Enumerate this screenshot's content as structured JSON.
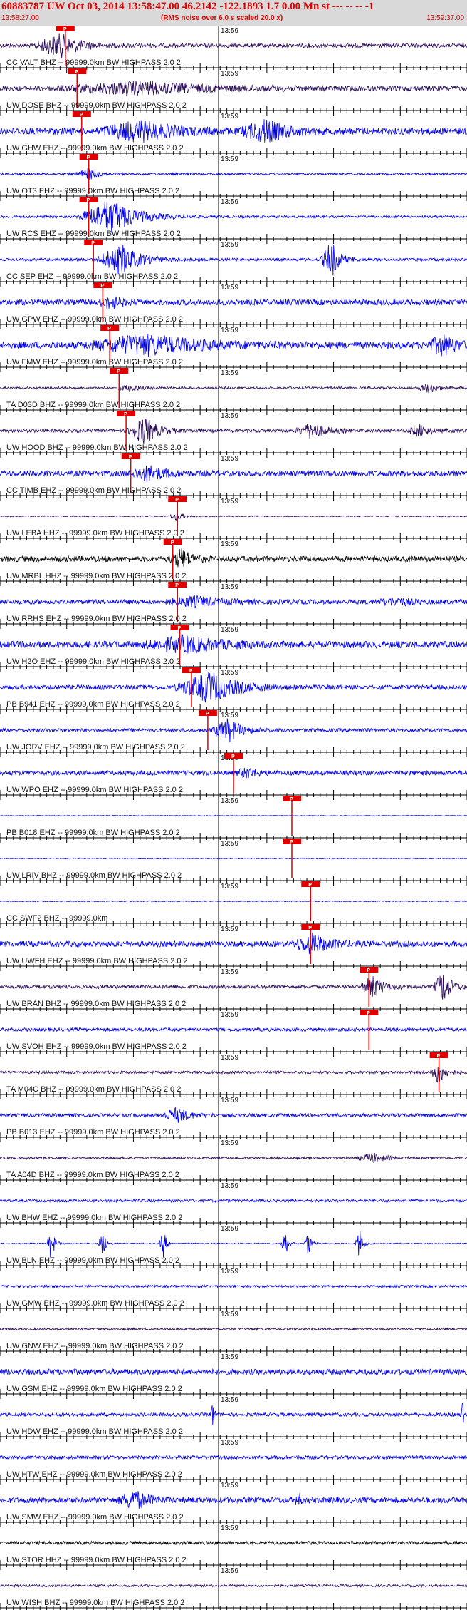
{
  "header": {
    "title": "60883787 UW Oct 03, 2014 13:58:47.00   46.2142 -122.1893  1.7 0.00 Mn st --- -- --  -1",
    "start_time": "13:58:27.00",
    "note": "(RMS noise over 6.0 s scaled 20.0 x)",
    "end_time": "13:59:37.00"
  },
  "pick_label": "P",
  "minute_label": "13:59",
  "colors": {
    "red": "#e00000",
    "blue": "#0000ee",
    "purple": "#2a0a5a",
    "black": "#000000"
  },
  "traces": [
    {
      "label": "CC VALT BHZ -- 99999.0km BW  HIGHPASS  2.0  2",
      "color": "purple",
      "pick": 0.14,
      "amp": 0.18,
      "bursts": [
        [
          0.13,
          0.06,
          1.0
        ]
      ]
    },
    {
      "label": "UW DOSE BHZ -- 99999.0km BW  HIGHPASS  2.0  2",
      "color": "purple",
      "pick": 0.165,
      "amp": 0.22,
      "bursts": [
        [
          0.3,
          0.2,
          0.5
        ]
      ]
    },
    {
      "label": "UW GHW EHZ -- 99999.0km BW  HIGHPASS  2.0  2",
      "color": "blue",
      "pick": 0.175,
      "amp": 0.3,
      "bursts": [
        [
          0.3,
          0.1,
          0.8
        ],
        [
          0.57,
          0.06,
          0.9
        ]
      ]
    },
    {
      "label": "UW OT3 EHZ -- 99999.0km BW  HIGHPASS  2.0  2",
      "color": "blue",
      "pick": 0.19,
      "amp": 0.1,
      "bursts": [
        [
          0.19,
          0.03,
          0.5
        ]
      ]
    },
    {
      "label": "UW RCS EHZ -- 99999.0km BW  HIGHPASS  2.0  2",
      "color": "blue",
      "pick": 0.19,
      "amp": 0.1,
      "bursts": [
        [
          0.24,
          0.08,
          1.5
        ]
      ]
    },
    {
      "label": "CC SEP EHZ -- 99999.0km BW  HIGHPASS  2.0  2",
      "color": "blue",
      "pick": 0.2,
      "amp": 0.12,
      "bursts": [
        [
          0.26,
          0.06,
          1.3
        ],
        [
          0.71,
          0.025,
          1.6
        ]
      ]
    },
    {
      "label": "UW GPW EHZ -- 99999.0km BW  HIGHPASS  2.0  2",
      "color": "blue",
      "pick": 0.22,
      "amp": 0.25,
      "bursts": [
        [
          0.24,
          0.03,
          0.5
        ]
      ]
    },
    {
      "label": "UW FMW EHZ -- 99999.0km BW  HIGHPASS  2.0  2",
      "color": "blue",
      "pick": 0.235,
      "amp": 0.3,
      "bursts": [
        [
          0.32,
          0.15,
          0.8
        ],
        [
          0.95,
          0.04,
          0.8
        ]
      ]
    },
    {
      "label": "TA D03D BHZ -- 99999.0km BW  HIGHPASS  2.0  2",
      "color": "purple",
      "pick": 0.255,
      "amp": 0.1,
      "bursts": [
        [
          0.28,
          0.03,
          0.3
        ],
        [
          0.92,
          0.03,
          0.4
        ]
      ]
    },
    {
      "label": "UW HOOD BHZ -- 99999.0km BW  HIGHPASS  2.0  2",
      "color": "purple",
      "pick": 0.27,
      "amp": 0.15,
      "bursts": [
        [
          0.31,
          0.04,
          1.2
        ],
        [
          0.67,
          0.04,
          0.7
        ],
        [
          0.9,
          0.03,
          0.5
        ]
      ]
    },
    {
      "label": "CC TIMB EHZ -- 99999.0km BW  HIGHPASS  2.0  2",
      "color": "blue",
      "pick": 0.28,
      "amp": 0.25,
      "bursts": [
        [
          0.32,
          0.05,
          0.6
        ]
      ]
    },
    {
      "label": "UW LEBA HHZ -- 99999.0km BW  HIGHPASS  2.0  2",
      "color": "purple",
      "pick": 0.38,
      "amp": 0.05,
      "bursts": [
        [
          0.38,
          0.02,
          0.4
        ]
      ]
    },
    {
      "label": "UW MRBL HHZ -- 99999.0km BW  HIGHPASS  2.0  2",
      "color": "black",
      "pick": 0.37,
      "amp": 0.25,
      "bursts": [
        [
          0.39,
          0.03,
          0.8
        ]
      ]
    },
    {
      "label": "UW RRHS EHZ -- 99999.0km BW  HIGHPASS  2.0  2",
      "color": "blue",
      "pick": 0.38,
      "amp": 0.2,
      "bursts": [
        [
          0.42,
          0.08,
          0.4
        ],
        [
          0.85,
          0.05,
          0.3
        ]
      ]
    },
    {
      "label": "UW H2O EHZ -- 99999.0km BW  HIGHPASS  2.0  2",
      "color": "blue",
      "pick": 0.385,
      "amp": 0.3,
      "bursts": [
        [
          0.4,
          0.1,
          0.6
        ]
      ]
    },
    {
      "label": "PB B941 EHZ -- 99999.0km BW  HIGHPASS  2.0  2",
      "color": "blue",
      "pick": 0.41,
      "amp": 0.2,
      "bursts": [
        [
          0.45,
          0.08,
          1.3
        ]
      ]
    },
    {
      "label": "UW JORV EHZ -- 99999.0km BW  HIGHPASS  2.0  2",
      "color": "blue",
      "pick": 0.445,
      "amp": 0.15,
      "bursts": [
        [
          0.49,
          0.04,
          1.0
        ]
      ]
    },
    {
      "label": "UW WPO EHZ -- 99999.0km BW  HIGHPASS  2.0  2",
      "color": "blue",
      "pick": 0.5,
      "amp": 0.2,
      "bursts": [
        [
          0.53,
          0.03,
          0.4
        ]
      ]
    },
    {
      "label": "PB B018 EHZ -- 99999.0km BW  HIGHPASS  2.0  2",
      "color": "blue",
      "pick": 0.625,
      "amp": 0.03,
      "bursts": []
    },
    {
      "label": "UW LRIV BHZ -- 99999.0km BW  HIGHPASS  2.0  2",
      "color": "blue",
      "pick": 0.625,
      "amp": 0.04,
      "bursts": []
    },
    {
      "label": "CC SWF2 BHZ -- 99999.0km",
      "color": "blue",
      "pick": 0.665,
      "amp": 0.04,
      "bursts": []
    },
    {
      "label": "UW UWFH EHZ -- 99999.0km BW  HIGHPASS  2.0  2",
      "color": "blue",
      "pick": 0.665,
      "amp": 0.25,
      "bursts": [
        [
          0.67,
          0.05,
          0.8
        ]
      ]
    },
    {
      "label": "UW BRAN BHZ -- 99999.0km BW  HIGHPASS  2.0  2",
      "color": "purple",
      "pick": 0.79,
      "amp": 0.15,
      "bursts": [
        [
          0.8,
          0.03,
          1.0
        ],
        [
          0.95,
          0.025,
          1.3
        ]
      ]
    },
    {
      "label": "UW SVOH EHZ -- 99999.0km BW  HIGHPASS  2.0  2",
      "color": "blue",
      "pick": 0.79,
      "amp": 0.15,
      "bursts": []
    },
    {
      "label": "TA M04C BHZ -- 99999.0km BW  HIGHPASS  2.0  2",
      "color": "purple",
      "pick": 0.94,
      "amp": 0.12,
      "bursts": [
        [
          0.94,
          0.02,
          1.0
        ]
      ]
    },
    {
      "label": "PB B013 EHZ -- 99999.0km BW  HIGHPASS  2.0  2",
      "color": "blue",
      "pick": null,
      "amp": 0.15,
      "bursts": [
        [
          0.38,
          0.04,
          0.6
        ]
      ]
    },
    {
      "label": "TA A04D BHZ -- 99999.0km BW  HIGHPASS  2.0  2",
      "color": "purple",
      "pick": null,
      "amp": 0.1,
      "bursts": [
        [
          0.8,
          0.04,
          0.4
        ]
      ]
    },
    {
      "label": "UW BHW EHZ -- 99999.0km BW  HIGHPASS  2.0  2",
      "color": "blue",
      "pick": null,
      "amp": 0.12,
      "bursts": []
    },
    {
      "label": "UW BLN EHZ -- 99999.0km BW  HIGHPASS  2.0  2",
      "color": "blue",
      "pick": null,
      "amp": 0.05,
      "bursts": [
        [
          0.11,
          0.01,
          1.5
        ],
        [
          0.22,
          0.01,
          1.2
        ],
        [
          0.35,
          0.01,
          1.2
        ],
        [
          0.61,
          0.01,
          1.3
        ],
        [
          0.66,
          0.01,
          1.1
        ],
        [
          0.77,
          0.01,
          1.4
        ]
      ]
    },
    {
      "label": "UW GMW EHZ -- 99999.0km BW  HIGHPASS  2.0  2",
      "color": "blue",
      "pick": null,
      "amp": 0.1,
      "bursts": []
    },
    {
      "label": "UW GNW EHZ -- 99999.0km BW  HIGHPASS  2.0  2",
      "color": "purple",
      "pick": null,
      "amp": 0.1,
      "bursts": []
    },
    {
      "label": "UW GSM EHZ -- 99999.0km BW  HIGHPASS  2.0  2",
      "color": "blue",
      "pick": null,
      "amp": 0.25,
      "bursts": []
    },
    {
      "label": "UW HDW EHZ -- 99999.0km BW  HIGHPASS  2.0  2",
      "color": "blue",
      "pick": null,
      "amp": 0.15,
      "bursts": [
        [
          0.455,
          0.005,
          1.4
        ],
        [
          0.99,
          0.005,
          1.2
        ]
      ]
    },
    {
      "label": "UW HTW EHZ -- 99999.0km BW  HIGHPASS  2.0  2",
      "color": "blue",
      "pick": null,
      "amp": 0.15,
      "bursts": []
    },
    {
      "label": "UW SMW EHZ -- 99999.0km BW  HIGHPASS  2.0  2",
      "color": "blue",
      "pick": null,
      "amp": 0.25,
      "bursts": [
        [
          0.29,
          0.04,
          0.8
        ],
        [
          0.64,
          0.01,
          0.6
        ]
      ]
    },
    {
      "label": "UW STOR HHZ -- 99999.0km BW  HIGHPASS  2.0  2",
      "color": "black",
      "pick": null,
      "amp": 0.15,
      "bursts": []
    },
    {
      "label": "UW WISH BHZ -- 99999.0km BW  HIGHPASS  2.0  2",
      "color": "purple",
      "pick": null,
      "amp": 0.1,
      "bursts": []
    }
  ]
}
